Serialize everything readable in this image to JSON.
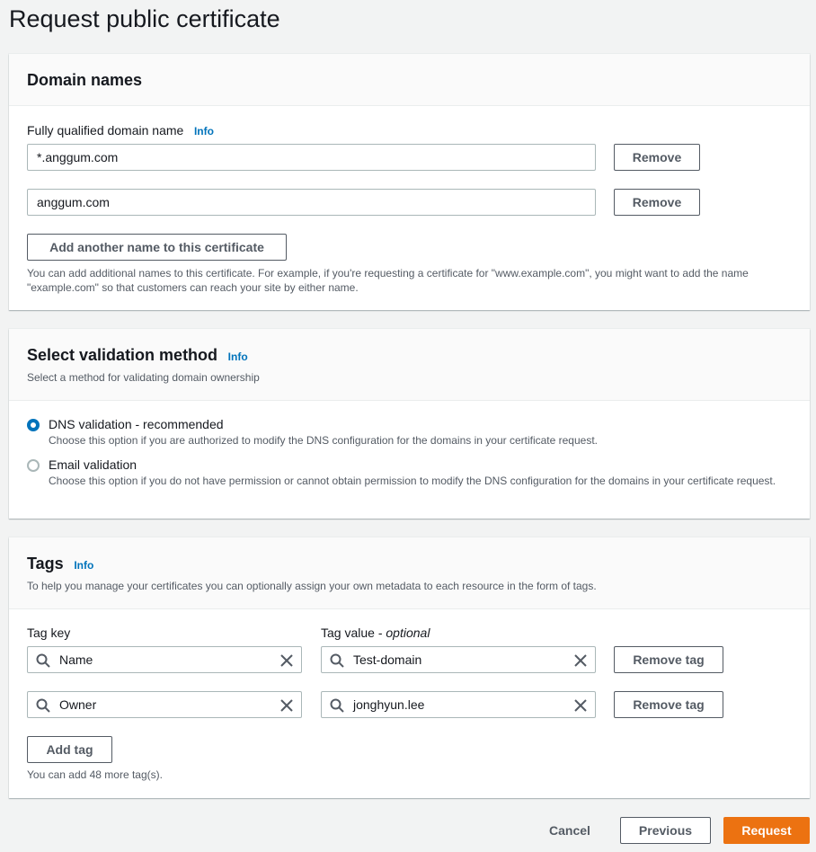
{
  "page": {
    "title": "Request public certificate"
  },
  "domain_names": {
    "title": "Domain names",
    "field_label": "Fully qualified domain name",
    "info": "Info",
    "entries": [
      {
        "value": "*.anggum.com",
        "remove_label": "Remove"
      },
      {
        "value": "anggum.com",
        "remove_label": "Remove"
      }
    ],
    "add_button": "Add another name to this certificate",
    "help_text": "You can add additional names to this certificate. For example, if you're requesting a certificate for \"www.example.com\", you might want to add the name \"example.com\" so that customers can reach your site by either name."
  },
  "validation": {
    "title": "Select validation method",
    "info": "Info",
    "description": "Select a method for validating domain ownership",
    "options": [
      {
        "label": "DNS validation - recommended",
        "description": "Choose this option if you are authorized to modify the DNS configuration for the domains in your certificate request.",
        "selected": true
      },
      {
        "label": "Email validation",
        "description": "Choose this option if you do not have permission or cannot obtain permission to modify the DNS configuration for the domains in your certificate request.",
        "selected": false
      }
    ]
  },
  "tags": {
    "title": "Tags",
    "info": "Info",
    "description": "To help you manage your certificates you can optionally assign your own metadata to each resource in the form of tags.",
    "key_header": "Tag key",
    "value_header": "Tag value",
    "value_optional": "optional",
    "rows": [
      {
        "key": "Name",
        "value": "Test-domain",
        "remove_label": "Remove tag"
      },
      {
        "key": "Owner",
        "value": "jonghyun.lee",
        "remove_label": "Remove tag"
      }
    ],
    "add_button": "Add tag",
    "limit_text": "You can add 48 more tag(s)."
  },
  "footer": {
    "cancel": "Cancel",
    "previous": "Previous",
    "request": "Request"
  },
  "colors": {
    "primary": "#ec7211",
    "link": "#0073bb",
    "radio_selected": "#0073bb"
  }
}
